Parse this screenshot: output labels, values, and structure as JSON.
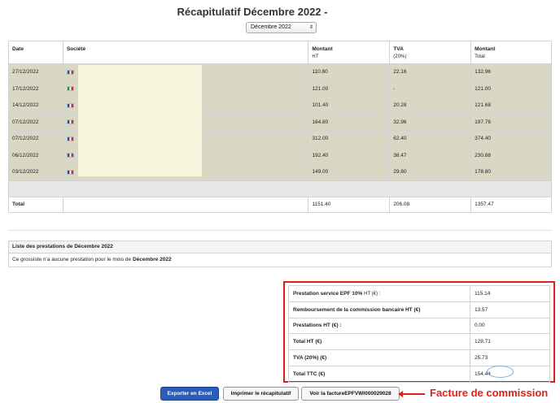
{
  "page": {
    "title": "Récapitulatif Décembre 2022 -"
  },
  "month_select": {
    "value": "Décembre 2022",
    "arrows": "⇕"
  },
  "table": {
    "headers": {
      "date": "Date",
      "company": "Société",
      "amount": "Montant",
      "amount_sub": "HT",
      "vat": "TVA",
      "vat_sub": "(20%)",
      "total": "Montant",
      "total_sub": "Total"
    },
    "rows": [
      {
        "date": "27/12/2022",
        "flag": "fr",
        "ht": "110.80",
        "vat": "22.16",
        "total": "132.96"
      },
      {
        "date": "17/12/2022",
        "flag": "it",
        "ht": "121.00",
        "vat": "-",
        "total": "121.00"
      },
      {
        "date": "14/12/2022",
        "flag": "fr",
        "ht": "101.40",
        "vat": "20.28",
        "total": "121.68"
      },
      {
        "date": "07/12/2022",
        "flag": "fr",
        "ht": "164.80",
        "vat": "32.96",
        "total": "197.76"
      },
      {
        "date": "07/12/2022",
        "flag": "fr",
        "ht": "312.00",
        "vat": "62.40",
        "total": "374.40"
      },
      {
        "date": "06/12/2022",
        "flag": "fr",
        "ht": "192.40",
        "vat": "38.47",
        "total": "230.88"
      },
      {
        "date": "03/12/2022",
        "flag": "fr",
        "ht": "149.00",
        "vat": "29.80",
        "total": "178.80"
      }
    ],
    "totals": {
      "label": "Total",
      "ht": "1151.40",
      "vat": "206.08",
      "total": "1357.47"
    }
  },
  "prestations": {
    "heading": "Liste des prestations de Décembre 2022",
    "message_prefix": "Ce grossiste n'a aucune prestation pour le mois de ",
    "message_month": "Décembre 2022"
  },
  "summary": {
    "rows": [
      {
        "label": "Prestation service EPF 10%",
        "label_small": "HT (€) :",
        "value": "115.14"
      },
      {
        "label": "Remboursement de la commission bancaire HT (€)",
        "label_small": "",
        "value": "13.57"
      },
      {
        "label": "Prestations HT (€) :",
        "label_small": "",
        "value": "0.00"
      },
      {
        "label": "Total HT (€)",
        "label_small": "",
        "value": "128.71"
      },
      {
        "label": "TVA (20%) (€)",
        "label_small": "",
        "value": "25.73"
      },
      {
        "label": "Total TTC (€)",
        "label_small": "",
        "value": "154.44"
      }
    ]
  },
  "buttons": {
    "export": "Exporter en Excel",
    "print": "Imprimer le récapitulatif",
    "invoice": "Voir la factureEPFVWI000029028"
  },
  "annotation": {
    "text": "Facture de commission",
    "color": "#e02020"
  },
  "colors": {
    "row_bg": "#d9d8c5",
    "primary": "#2a5cb8",
    "annotation_red": "#e02020",
    "highlight_oval": "#7aa9e6"
  }
}
